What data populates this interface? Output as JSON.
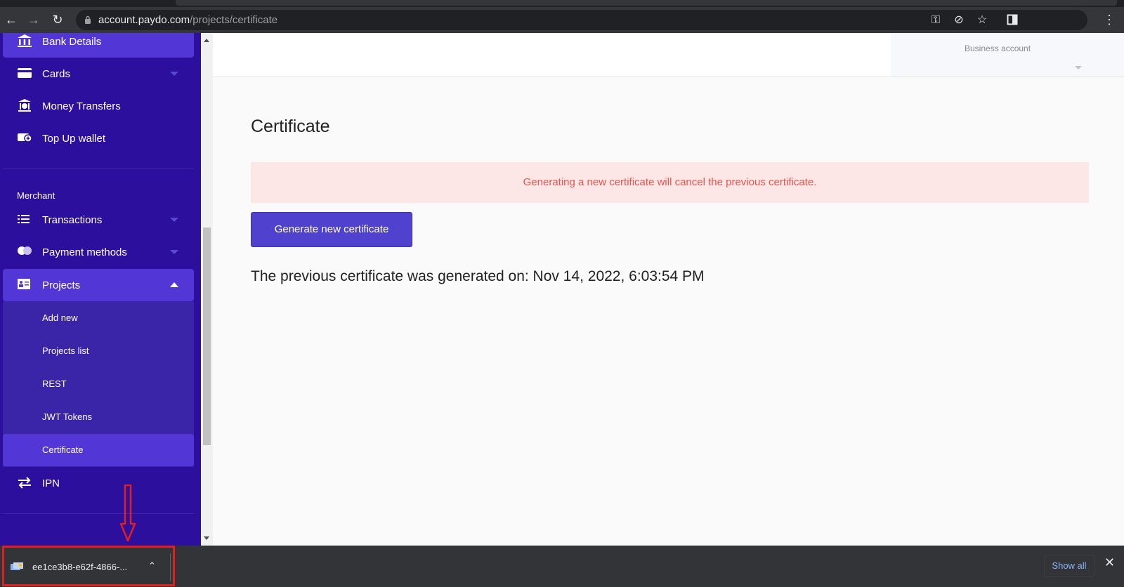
{
  "browser": {
    "url_host": "account.paydo.com",
    "url_path": "/projects/certificate"
  },
  "sidebar": {
    "top_items": [
      {
        "label": "Bank Details",
        "icon": "bank-icon"
      },
      {
        "label": "Cards",
        "icon": "card-icon"
      },
      {
        "label": "Money Transfers",
        "icon": "money-transfer-icon"
      },
      {
        "label": "Top Up wallet",
        "icon": "wallet-topup-icon"
      }
    ],
    "section_label": "Merchant",
    "merchant_items": [
      {
        "label": "Transactions",
        "icon": "list-icon"
      },
      {
        "label": "Payment methods",
        "icon": "payment-methods-icon"
      },
      {
        "label": "Projects",
        "icon": "projects-icon"
      }
    ],
    "project_subitems": [
      {
        "label": "Add new"
      },
      {
        "label": "Projects list"
      },
      {
        "label": "REST"
      },
      {
        "label": "JWT Tokens"
      },
      {
        "label": "Certificate"
      }
    ],
    "ipn_label": "IPN"
  },
  "header": {
    "account_label": "Business account"
  },
  "main": {
    "title": "Certificate",
    "alert_text": "Generating a new certificate will cancel the previous certificate.",
    "generate_button": "Generate new certificate",
    "previous_cert_text": "The previous certificate was generated on: Nov 14, 2022, 6:03:54 PM"
  },
  "download_bar": {
    "file_name": "ee1ce3b8-e62f-4866-...",
    "show_all": "Show all"
  },
  "colors": {
    "sidebar_bg": "#2d0f9e",
    "sidebar_active": "#5237d6",
    "button_bg": "#5041cf",
    "alert_text": "#e8534c",
    "alert_bg": "#fde6e6",
    "annotation": "#e01f1f"
  }
}
